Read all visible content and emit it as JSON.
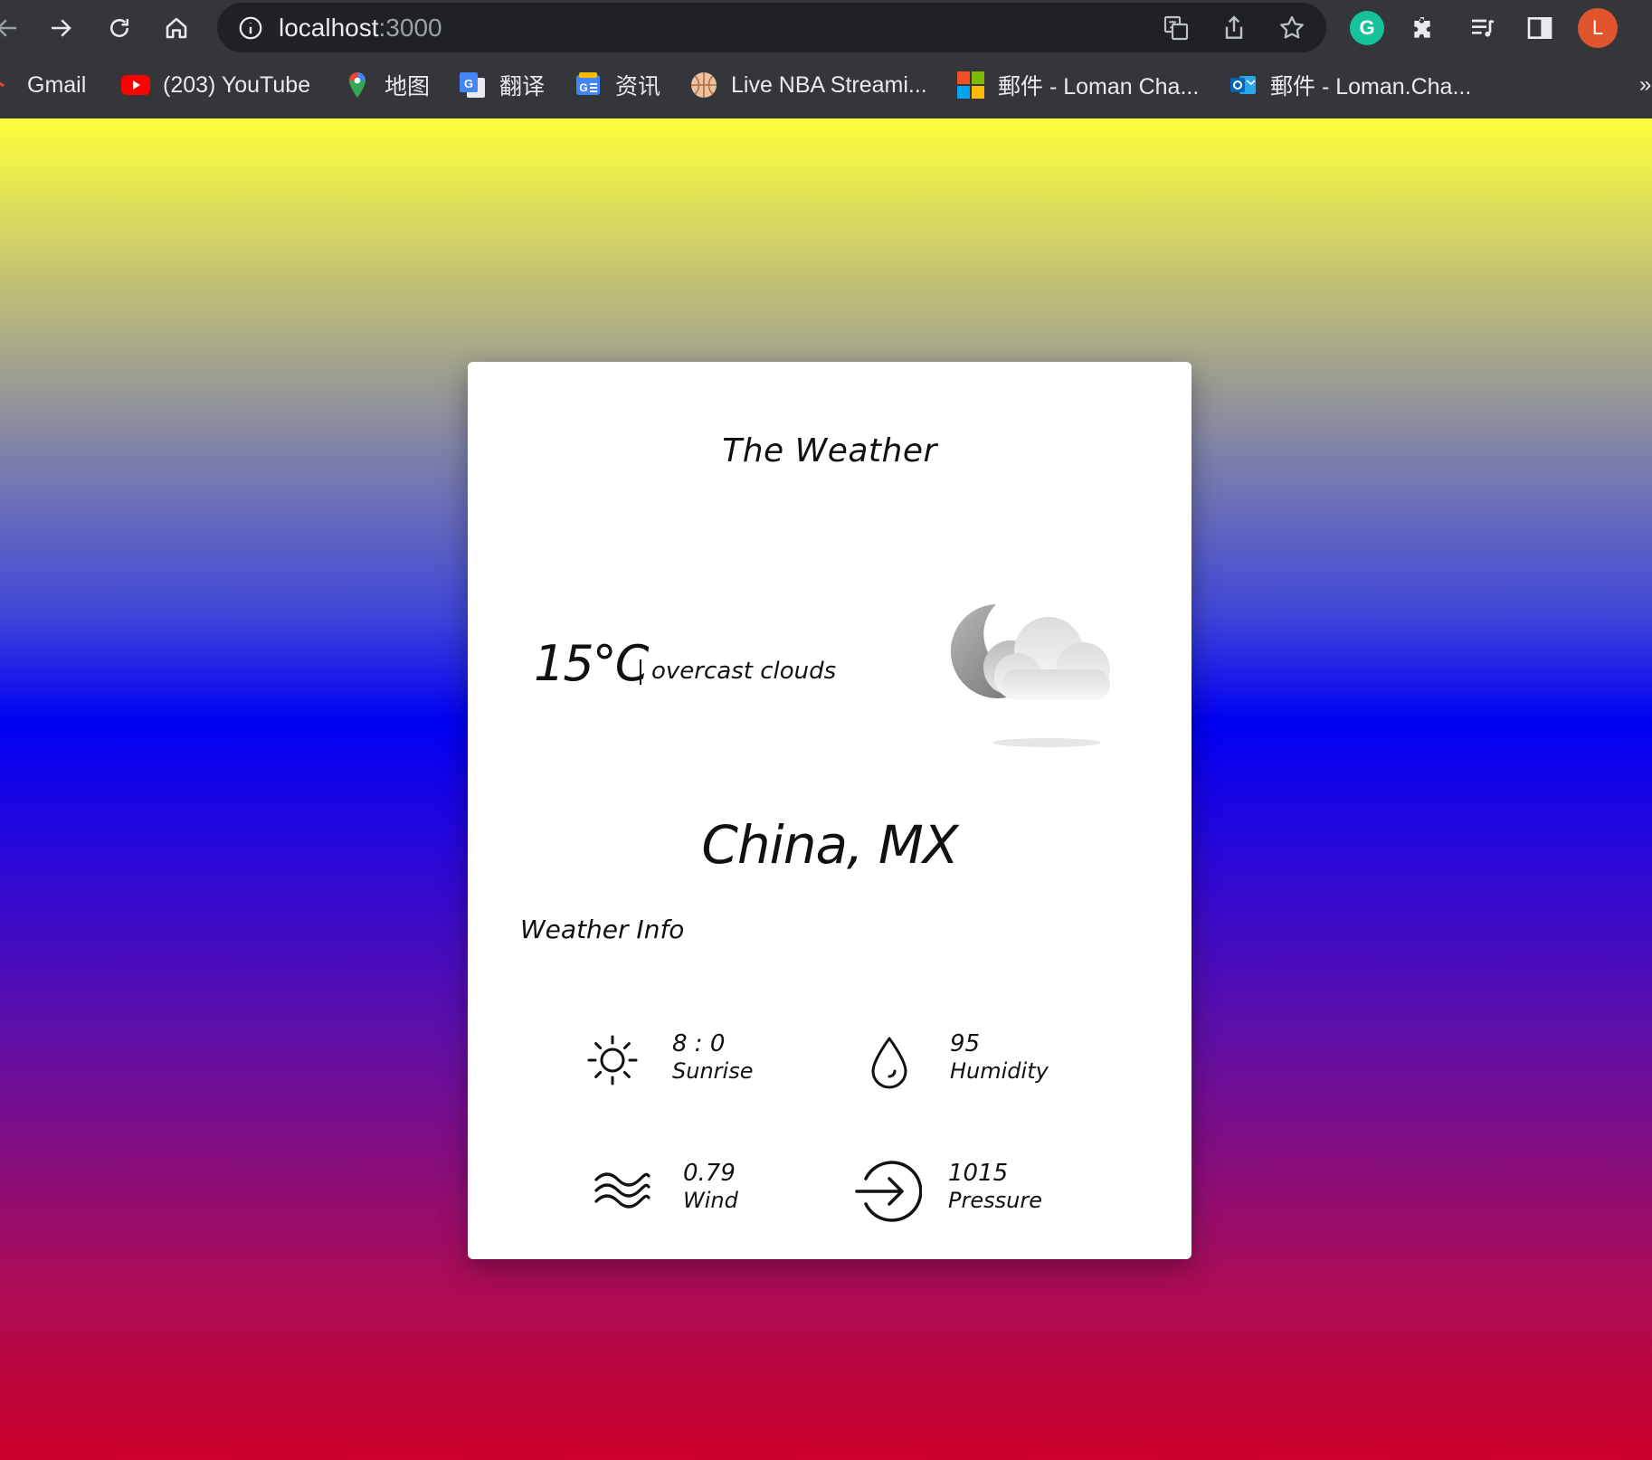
{
  "browser": {
    "url_host": "localhost",
    "url_port": ":3000",
    "avatar_initial": "L",
    "grammarly_letter": "G",
    "bookmarks": [
      {
        "label": "Gmail",
        "icon": "gmail-icon"
      },
      {
        "label": "(203) YouTube",
        "icon": "youtube-icon"
      },
      {
        "label": "地图",
        "icon": "maps-icon"
      },
      {
        "label": "翻译",
        "icon": "translate-icon"
      },
      {
        "label": "资讯",
        "icon": "news-icon"
      },
      {
        "label": "Live NBA Streami...",
        "icon": "basketball-icon"
      },
      {
        "label": "郵件 - Loman Cha...",
        "icon": "microsoft-icon"
      },
      {
        "label": "郵件 - Loman.Cha...",
        "icon": "outlook-icon"
      }
    ],
    "more_label": "»"
  },
  "weather": {
    "title": "The Weather",
    "temperature": "15°C",
    "description": "overcast clouds",
    "condition_icon": "moon-cloud-icon",
    "location": "China, MX",
    "info_heading": "Weather Info",
    "items": [
      {
        "value": "8 : 0",
        "label": "Sunrise",
        "icon": "sun-icon"
      },
      {
        "value": "95",
        "label": "Humidity",
        "icon": "droplet-icon"
      },
      {
        "value": "0.79",
        "label": "Wind",
        "icon": "wind-icon"
      },
      {
        "value": "1015",
        "label": "Pressure",
        "icon": "arrow-circle-icon"
      }
    ]
  },
  "colors": {
    "gradient_top": "#ffff3c",
    "gradient_middle": "#0000f4",
    "gradient_bottom": "#cc0029",
    "card_background": "#ffffff",
    "chrome_background": "#35363a"
  }
}
